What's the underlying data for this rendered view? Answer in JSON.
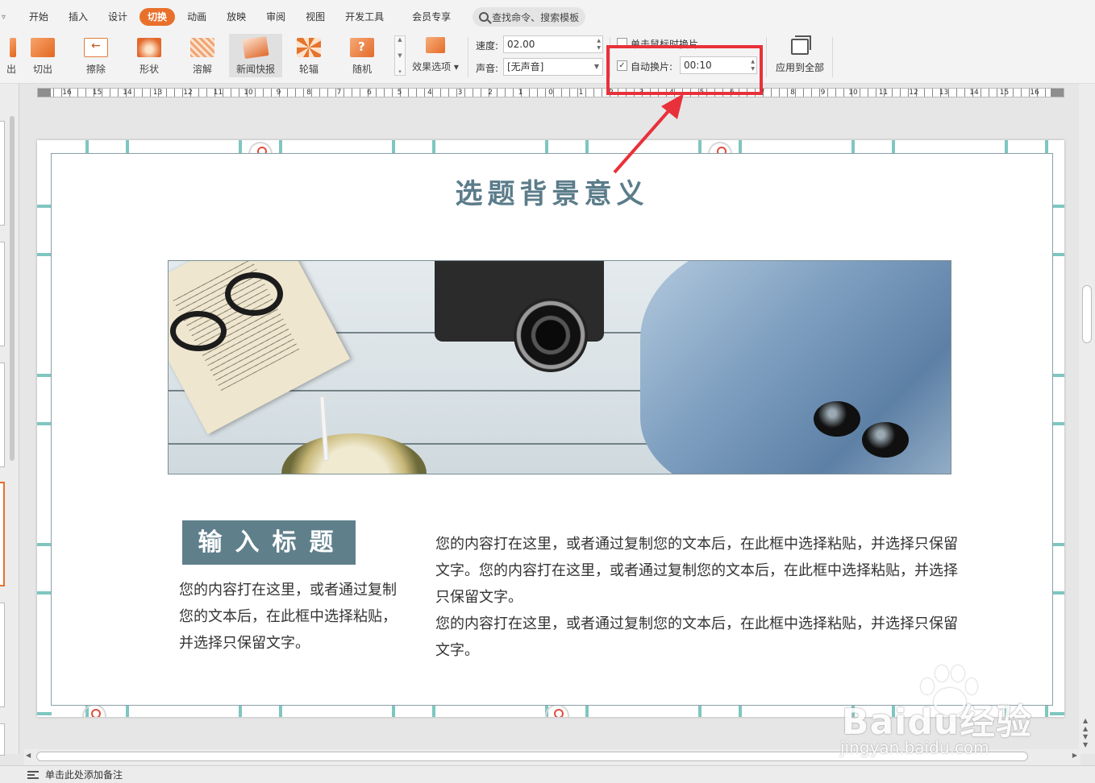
{
  "menu": {
    "tabs": [
      "开始",
      "插入",
      "设计",
      "切换",
      "动画",
      "放映",
      "审阅",
      "视图",
      "开发工具",
      "会员专享"
    ],
    "active_tab": "切换",
    "search_placeholder": "查找命令、搜索模板"
  },
  "ribbon": {
    "effects": [
      {
        "label": "出",
        "icon": "partial-effect-icon"
      },
      {
        "label": "切出",
        "icon": "cut-out-icon"
      },
      {
        "label": "擦除",
        "icon": "wipe-icon"
      },
      {
        "label": "形状",
        "icon": "shape-icon"
      },
      {
        "label": "溶解",
        "icon": "dissolve-icon"
      },
      {
        "label": "新闻快报",
        "icon": "newsflash-icon"
      },
      {
        "label": "轮辐",
        "icon": "wheel-icon"
      },
      {
        "label": "随机",
        "icon": "random-icon"
      }
    ],
    "selected_effect": "新闻快报",
    "effect_options_label": "效果选项",
    "speed_label": "速度:",
    "speed_value": "02.00",
    "sound_label": "声音:",
    "sound_value": "[无声音]",
    "on_click_label": "单击鼠标时换片",
    "on_click_checked": false,
    "auto_advance_label": "自动换片:",
    "auto_advance_checked": true,
    "auto_advance_value": "00:10",
    "apply_all_label": "应用到全部"
  },
  "ruler": {
    "ticks": [
      "16",
      "15",
      "14",
      "13",
      "12",
      "11",
      "10",
      "9",
      "8",
      "7",
      "6",
      "5",
      "4",
      "3",
      "2",
      "1",
      "0",
      "1",
      "2",
      "3",
      "4",
      "5",
      "6",
      "7",
      "8",
      "9",
      "10",
      "11",
      "12",
      "13",
      "14",
      "15",
      "16"
    ]
  },
  "slide": {
    "title": "选题背景意义",
    "tag": "输入标题",
    "left_text": "您的内容打在这里，或者通过复制您的文本后，在此框中选择粘贴，并选择只保留文字。",
    "right_text_1": "您的内容打在这里，或者通过复制您的文本后，在此框中选择粘贴，并选择只保留文字。您的内容打在这里，或者通过复制您的文本后，在此框中选择粘贴，并选择只保留文字。",
    "right_text_2": "您的内容打在这里，或者通过复制您的文本后，在此框中选择粘贴，并选择只保留文字。"
  },
  "notes": {
    "placeholder": "单击此处添加备注"
  },
  "watermark": {
    "logo": "Baidu经验",
    "url": "jingyan.baidu.com"
  },
  "colors": {
    "accent": "#e8702a",
    "highlight": "#e8313a",
    "slate": "#5f7f8b"
  }
}
